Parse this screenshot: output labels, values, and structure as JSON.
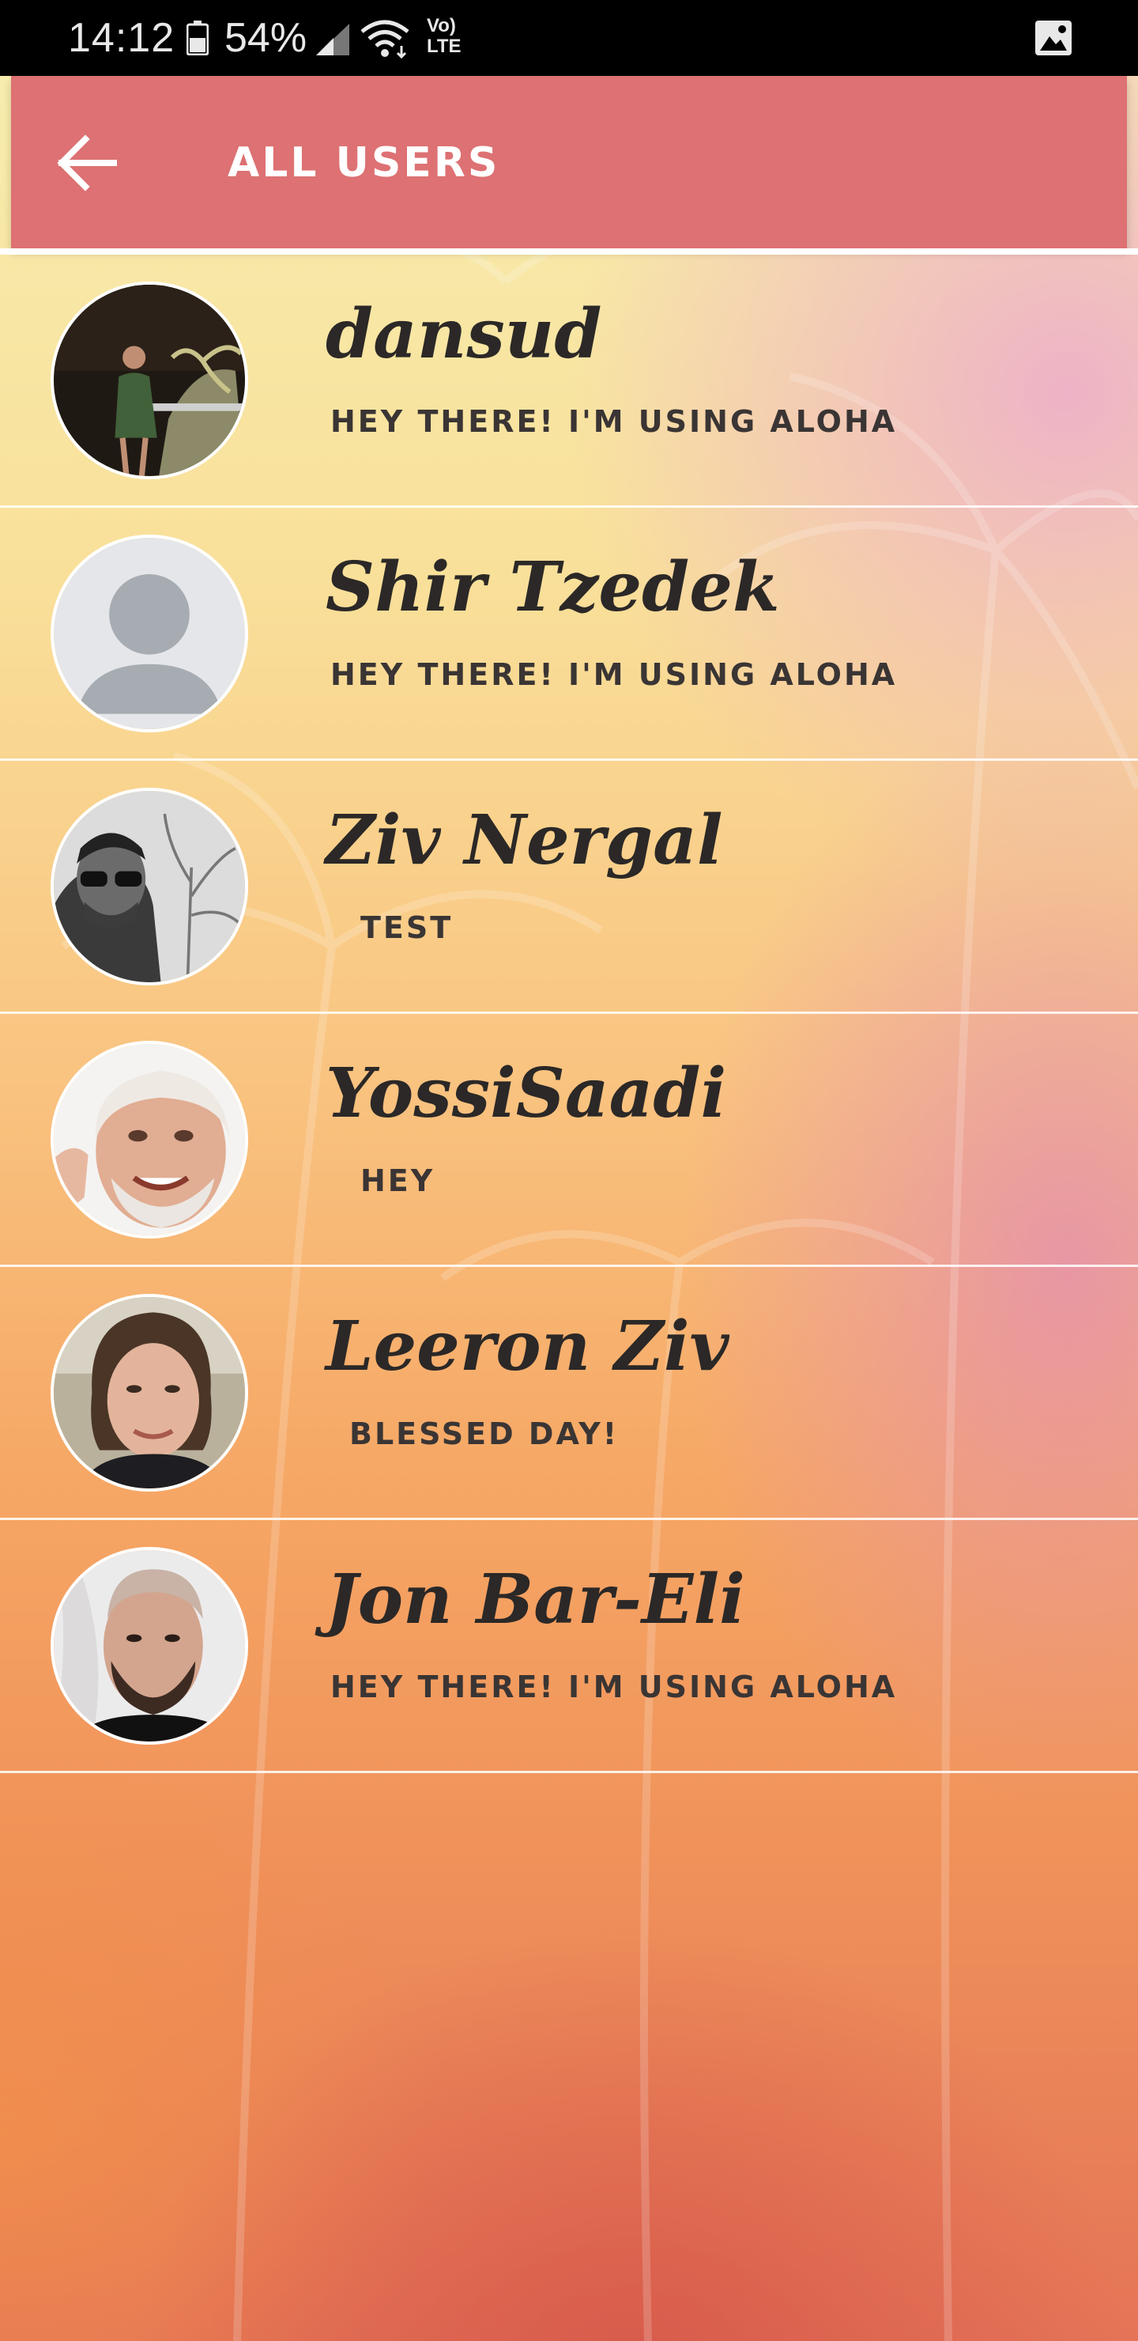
{
  "status_bar": {
    "time": "14:12",
    "battery": "54%",
    "network_top": "Vo)",
    "network_bottom": "LTE",
    "icons": [
      "battery-icon",
      "signal-icon",
      "wifi-icon",
      "image-icon"
    ]
  },
  "app_bar": {
    "title": "ALL USERS",
    "back_icon": "arrow-left-icon",
    "color": "#dd7173"
  },
  "users": [
    {
      "name": "dansud",
      "status": "HEY THERE! I'M USING ALOHA",
      "avatar": "photo-woman-palm"
    },
    {
      "name": "Shir Tzedek",
      "status": "HEY THERE! I'M USING ALOHA",
      "avatar": "default-avatar"
    },
    {
      "name": "Ziv Nergal",
      "status": "TEST",
      "avatar": "photo-man-sunglasses"
    },
    {
      "name": "YossiSaadi",
      "status": "HEY",
      "avatar": "photo-older-man"
    },
    {
      "name": "Leeron Ziv",
      "status": "BLESSED DAY!",
      "avatar": "photo-woman"
    },
    {
      "name": "Jon Bar-Eli",
      "status": "HEY THERE! I'M USING ALOHA",
      "avatar": "photo-man"
    }
  ],
  "colors": {
    "text_dark": "#2b2827",
    "divider": "#ffffff"
  }
}
